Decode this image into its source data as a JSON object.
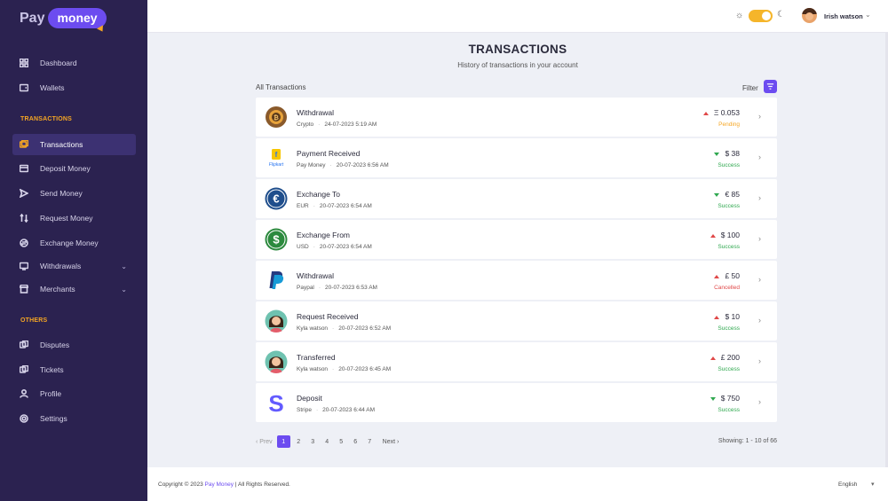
{
  "brand": {
    "pay": "Pay",
    "money": "money"
  },
  "sidebar": {
    "items_top": [
      {
        "label": "Dashboard",
        "icon": "dashboard-icon"
      },
      {
        "label": "Wallets",
        "icon": "wallet-icon"
      }
    ],
    "section_transactions": "TRANSACTIONS",
    "items_tx": [
      {
        "label": "Transactions",
        "icon": "transactions-icon",
        "active": true
      },
      {
        "label": "Deposit Money",
        "icon": "deposit-icon"
      },
      {
        "label": "Send Money",
        "icon": "send-icon"
      },
      {
        "label": "Request Money",
        "icon": "request-icon"
      },
      {
        "label": "Exchange Money",
        "icon": "exchange-icon"
      },
      {
        "label": "Withdrawals",
        "icon": "withdrawal-icon",
        "has_submenu": true
      },
      {
        "label": "Merchants",
        "icon": "merchant-icon",
        "has_submenu": true
      }
    ],
    "section_others": "OTHERS",
    "items_others": [
      {
        "label": "Disputes",
        "icon": "dispute-icon"
      },
      {
        "label": "Tickets",
        "icon": "ticket-icon"
      },
      {
        "label": "Profile",
        "icon": "profile-icon"
      },
      {
        "label": "Settings",
        "icon": "settings-icon"
      }
    ]
  },
  "header": {
    "user_name": "Irish watson",
    "theme_toggle_on": true
  },
  "main": {
    "title": "TRANSACTIONS",
    "subtitle": "History of transactions in your account",
    "list_label": "All Transactions",
    "filter_label": "Filter"
  },
  "transactions": [
    {
      "title": "Withdrawal",
      "source": "Crypto",
      "date": "24-07-2023 5:19 AM",
      "amount": "Ξ 0.053",
      "direction": "up",
      "status": "Pending",
      "status_color": "#f5a623",
      "icon": "crypto-gear-icon"
    },
    {
      "title": "Payment Received",
      "source": "Pay Money",
      "date": "20-07-2023 6:56 AM",
      "amount": "$ 38",
      "direction": "down",
      "status": "Success",
      "status_color": "#2fa84f",
      "icon": "flipkart-icon"
    },
    {
      "title": "Exchange To",
      "source": "EUR",
      "date": "20-07-2023 6:54 AM",
      "amount": "€ 85",
      "direction": "down",
      "status": "Success",
      "status_color": "#2fa84f",
      "icon": "euro-icon"
    },
    {
      "title": "Exchange From",
      "source": "USD",
      "date": "20-07-2023 6:54 AM",
      "amount": "$ 100",
      "direction": "up",
      "status": "Success",
      "status_color": "#2fa84f",
      "icon": "dollar-icon"
    },
    {
      "title": "Withdrawal",
      "source": "Paypal",
      "date": "20-07-2023 6:53 AM",
      "amount": "£ 50",
      "direction": "up",
      "status": "Cancelled",
      "status_color": "#e04848",
      "icon": "paypal-icon"
    },
    {
      "title": "Request Received",
      "source": "Kyla watson",
      "date": "20-07-2023 6:52 AM",
      "amount": "$ 10",
      "direction": "up",
      "status": "Success",
      "status_color": "#2fa84f",
      "icon": "user-avatar-icon"
    },
    {
      "title": "Transferred",
      "source": "Kyla watson",
      "date": "20-07-2023 6:45 AM",
      "amount": "£ 200",
      "direction": "up",
      "status": "Success",
      "status_color": "#2fa84f",
      "icon": "user-avatar-icon"
    },
    {
      "title": "Deposit",
      "source": "Stripe",
      "date": "20-07-2023 6:44 AM",
      "amount": "$ 750",
      "direction": "down",
      "status": "Success",
      "status_color": "#2fa84f",
      "icon": "stripe-icon"
    }
  ],
  "pagination": {
    "prev": "‹ Prev",
    "next": "Next ›",
    "pages": [
      "1",
      "2",
      "3",
      "4",
      "5",
      "6",
      "7"
    ],
    "current": "1",
    "showing": "Showing: 1 - 10 of 66"
  },
  "footer": {
    "copyright_prefix": "Copyright © 2023",
    "copyright_brand": "Pay Money",
    "copyright_suffix": "| All Rights Reserved.",
    "language": "English"
  }
}
